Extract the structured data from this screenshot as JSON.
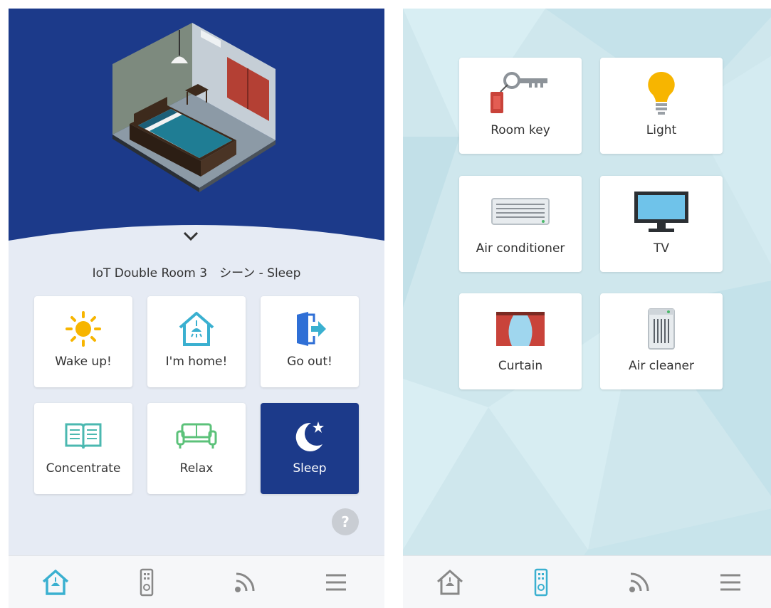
{
  "colors": {
    "hero_navy": "#1c3a8a",
    "accent_cyan": "#3ab0d0",
    "card_white": "#ffffff",
    "left_bg": "#e6ebf4",
    "right_bg": "#cfe7ed",
    "nav_grey": "#888888"
  },
  "left": {
    "room_title": "IoT Double Room 3　シーン - Sleep",
    "scenes": [
      {
        "label": "Wake up!",
        "icon": "sun-icon"
      },
      {
        "label": "I'm home!",
        "icon": "home-light-icon"
      },
      {
        "label": "Go out!",
        "icon": "door-exit-icon"
      },
      {
        "label": "Concentrate",
        "icon": "book-icon"
      },
      {
        "label": "Relax",
        "icon": "sofa-icon"
      },
      {
        "label": "Sleep",
        "icon": "moon-star-icon",
        "active": true
      }
    ],
    "help_label": "?",
    "nav": [
      {
        "icon": "home-nav-icon",
        "active": true
      },
      {
        "icon": "remote-nav-icon",
        "active": false
      },
      {
        "icon": "wireless-nav-icon",
        "active": false
      },
      {
        "icon": "menu-nav-icon",
        "active": false
      }
    ]
  },
  "right": {
    "devices": [
      {
        "label": "Room key",
        "icon": "room-key-icon"
      },
      {
        "label": "Light",
        "icon": "light-bulb-icon"
      },
      {
        "label": "Air conditioner",
        "icon": "air-conditioner-icon"
      },
      {
        "label": "TV",
        "icon": "tv-icon"
      },
      {
        "label": "Curtain",
        "icon": "curtain-icon"
      },
      {
        "label": "Air cleaner",
        "icon": "air-cleaner-icon"
      }
    ],
    "nav": [
      {
        "icon": "home-nav-icon",
        "active": false
      },
      {
        "icon": "remote-nav-icon",
        "active": true
      },
      {
        "icon": "wireless-nav-icon",
        "active": false
      },
      {
        "icon": "menu-nav-icon",
        "active": false
      }
    ]
  }
}
